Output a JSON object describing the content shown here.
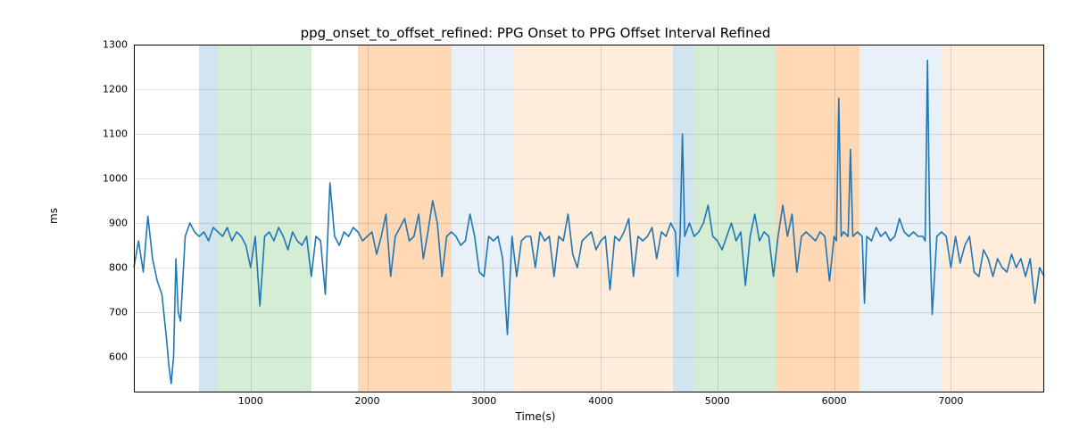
{
  "chart_data": {
    "type": "line",
    "title": "ppg_onset_to_offset_refined: PPG Onset to PPG Offset Interval Refined",
    "xlabel": "Time(s)",
    "ylabel": "ms",
    "xlim": [
      0,
      7800
    ],
    "ylim": [
      520,
      1300
    ],
    "x_ticks": [
      1000,
      2000,
      3000,
      4000,
      5000,
      6000,
      7000
    ],
    "y_ticks": [
      600,
      700,
      800,
      900,
      1000,
      1100,
      1200,
      1300
    ],
    "bands": [
      {
        "x0": 560,
        "x1": 720,
        "color": "blue"
      },
      {
        "x0": 720,
        "x1": 1520,
        "color": "green"
      },
      {
        "x0": 1920,
        "x1": 2720,
        "color": "orange"
      },
      {
        "x0": 2720,
        "x1": 3260,
        "color": "ltblue"
      },
      {
        "x0": 3260,
        "x1": 4620,
        "color": "ltoran"
      },
      {
        "x0": 4620,
        "x1": 4800,
        "color": "blue"
      },
      {
        "x0": 4800,
        "x1": 5500,
        "color": "green"
      },
      {
        "x0": 5500,
        "x1": 6220,
        "color": "orange"
      },
      {
        "x0": 6220,
        "x1": 6920,
        "color": "ltblue"
      },
      {
        "x0": 6920,
        "x1": 7800,
        "color": "ltoran"
      }
    ],
    "series": [
      {
        "name": "ppg_onset_to_offset_refined",
        "x": [
          0,
          40,
          80,
          120,
          160,
          200,
          240,
          260,
          280,
          300,
          320,
          340,
          360,
          380,
          400,
          440,
          480,
          520,
          560,
          600,
          640,
          680,
          720,
          760,
          800,
          840,
          880,
          920,
          960,
          1000,
          1040,
          1080,
          1120,
          1160,
          1200,
          1240,
          1280,
          1320,
          1360,
          1400,
          1440,
          1480,
          1520,
          1560,
          1600,
          1640,
          1680,
          1720,
          1760,
          1800,
          1840,
          1880,
          1920,
          1960,
          2000,
          2040,
          2080,
          2120,
          2160,
          2200,
          2240,
          2280,
          2320,
          2360,
          2400,
          2440,
          2480,
          2520,
          2560,
          2600,
          2640,
          2680,
          2720,
          2760,
          2800,
          2840,
          2880,
          2920,
          2960,
          3000,
          3040,
          3080,
          3120,
          3160,
          3200,
          3240,
          3280,
          3320,
          3360,
          3400,
          3440,
          3480,
          3520,
          3560,
          3600,
          3640,
          3680,
          3720,
          3760,
          3800,
          3840,
          3880,
          3920,
          3960,
          4000,
          4040,
          4080,
          4120,
          4160,
          4200,
          4240,
          4280,
          4320,
          4360,
          4400,
          4440,
          4480,
          4520,
          4560,
          4600,
          4640,
          4660,
          4680,
          4700,
          4720,
          4760,
          4800,
          4840,
          4880,
          4920,
          4960,
          5000,
          5040,
          5080,
          5120,
          5160,
          5200,
          5240,
          5280,
          5320,
          5360,
          5400,
          5440,
          5480,
          5520,
          5560,
          5600,
          5640,
          5680,
          5720,
          5760,
          5800,
          5840,
          5880,
          5920,
          5960,
          6000,
          6020,
          6040,
          6060,
          6080,
          6120,
          6140,
          6160,
          6200,
          6240,
          6260,
          6280,
          6320,
          6360,
          6400,
          6440,
          6480,
          6520,
          6560,
          6600,
          6640,
          6680,
          6720,
          6760,
          6780,
          6800,
          6820,
          6840,
          6880,
          6920,
          6960,
          7000,
          7040,
          7080,
          7120,
          7160,
          7200,
          7240,
          7280,
          7320,
          7360,
          7400,
          7440,
          7480,
          7520,
          7560,
          7600,
          7640,
          7680,
          7720,
          7760,
          7800
        ],
        "y": [
          800,
          860,
          790,
          915,
          820,
          770,
          740,
          690,
          640,
          580,
          540,
          600,
          820,
          700,
          680,
          870,
          900,
          880,
          870,
          880,
          860,
          890,
          880,
          870,
          890,
          860,
          880,
          870,
          850,
          800,
          870,
          714,
          870,
          880,
          860,
          890,
          870,
          840,
          880,
          860,
          850,
          870,
          780,
          870,
          860,
          740,
          990,
          870,
          850,
          880,
          870,
          890,
          880,
          860,
          870,
          880,
          830,
          870,
          920,
          780,
          870,
          890,
          910,
          860,
          870,
          920,
          820,
          880,
          950,
          900,
          780,
          870,
          880,
          870,
          850,
          860,
          920,
          870,
          790,
          780,
          870,
          860,
          870,
          820,
          650,
          870,
          780,
          860,
          870,
          870,
          800,
          880,
          860,
          870,
          780,
          870,
          860,
          920,
          830,
          800,
          860,
          870,
          880,
          840,
          860,
          870,
          750,
          870,
          860,
          880,
          910,
          780,
          870,
          860,
          870,
          890,
          820,
          880,
          870,
          900,
          880,
          780,
          870,
          1100,
          870,
          900,
          870,
          880,
          900,
          940,
          870,
          860,
          840,
          870,
          900,
          860,
          880,
          760,
          870,
          920,
          860,
          880,
          870,
          780,
          870,
          940,
          870,
          920,
          790,
          870,
          880,
          870,
          860,
          880,
          870,
          770,
          870,
          860,
          1180,
          870,
          880,
          870,
          1065,
          870,
          880,
          870,
          720,
          870,
          860,
          890,
          870,
          880,
          860,
          870,
          910,
          880,
          870,
          880,
          870,
          870,
          860,
          1265,
          870,
          695,
          870,
          880,
          870,
          800,
          870,
          810,
          850,
          870,
          790,
          780,
          840,
          820,
          780,
          820,
          800,
          790,
          830,
          800,
          820,
          780,
          820,
          720,
          800,
          780
        ]
      }
    ]
  }
}
